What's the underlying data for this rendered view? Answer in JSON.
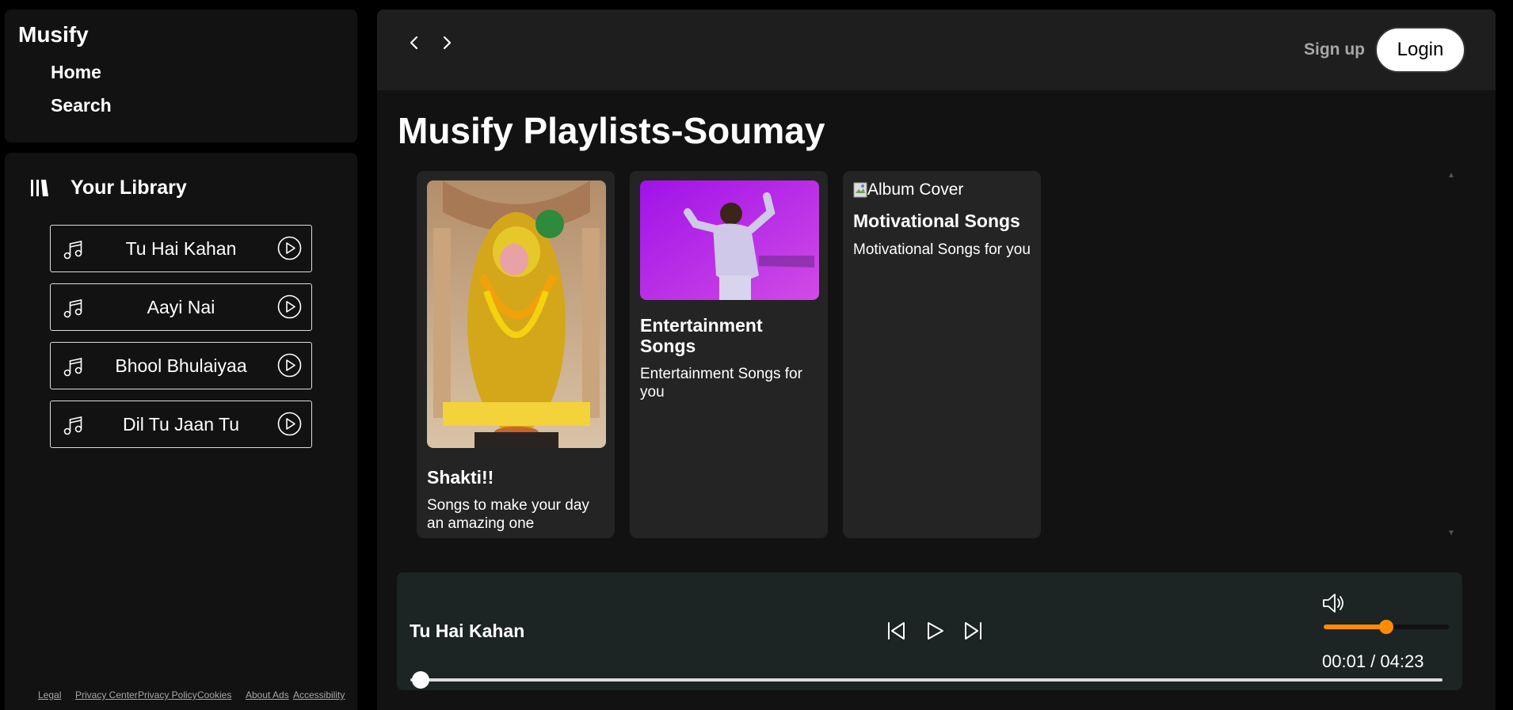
{
  "sidebar": {
    "brand": "Musify",
    "nav": {
      "home": "Home",
      "search": "Search"
    },
    "library_title": "Your Library",
    "library_items": [
      {
        "name": "Tu Hai Kahan"
      },
      {
        "name": "Aayi Nai"
      },
      {
        "name": "Bhool Bhulaiyaa"
      },
      {
        "name": "Dil Tu Jaan Tu"
      }
    ],
    "footer_links": [
      "Legal",
      "Privacy Center",
      "Privacy Policy",
      "Cookies",
      "About Ads",
      "Accessibility"
    ]
  },
  "topbar": {
    "signup_label": "Sign up",
    "login_label": "Login"
  },
  "main": {
    "title": "Musify Playlists-Soumay",
    "cards": [
      {
        "title": "Shakti!!",
        "description": "Songs to make your day an amazing one"
      },
      {
        "title": "Entertainment Songs",
        "description": "Entertainment Songs for you"
      },
      {
        "title": "Motivational Songs",
        "description": "Motivational Songs for you",
        "image_alt": "Album Cover"
      }
    ]
  },
  "player": {
    "track_title": "Tu Hai Kahan",
    "time_display": "00:01 / 04:23",
    "volume_fraction": 0.5,
    "progress_fraction": 0.01
  },
  "colors": {
    "accent": "#ff8c00",
    "player_bg": "#1c2424",
    "panel_bg": "#121212"
  }
}
